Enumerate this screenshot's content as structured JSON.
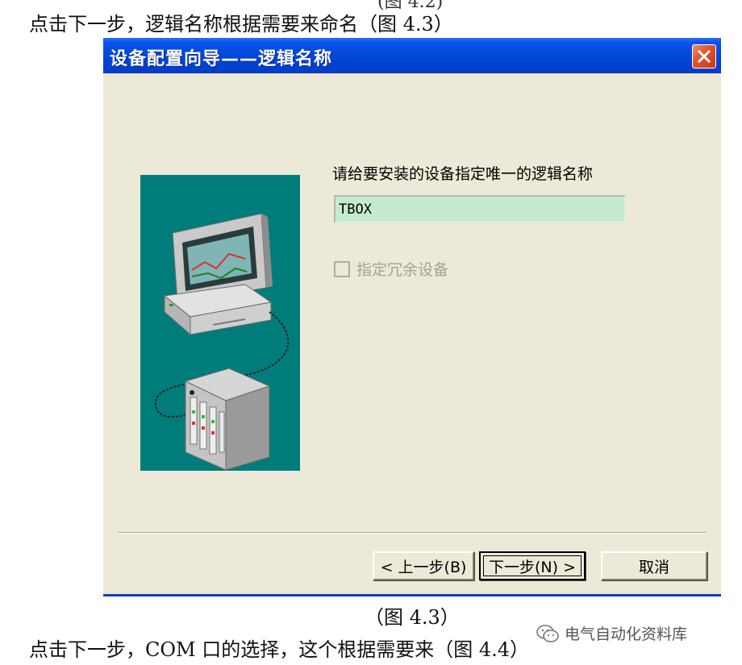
{
  "document": {
    "top_cut_text": "(图 4.2)",
    "top_line": "点击下一步，逻辑名称根据需要来命名（图 4.3）",
    "caption": "（图 4.3）",
    "bottom_line": "点击下一步，COM 口的选择，这个根据需要来（图 4.4）"
  },
  "dialog": {
    "title": "设备配置向导——逻辑名称",
    "close_icon": "close-icon",
    "prompt_label": "请给要安装的设备指定唯一的逻辑名称",
    "logical_name_value": "TBOX",
    "redundant_checkbox_label": "指定冗余设备",
    "redundant_checked": false,
    "buttons": {
      "back": "< 上一步(B)",
      "next": "下一步(N) >",
      "cancel": "取消"
    }
  },
  "watermark": {
    "icon": "wechat-icon",
    "text": "电气自动化资料库"
  },
  "colors": {
    "titlebar": "#0147d9",
    "dialog_bg": "#ece9d8",
    "illustration_bg": "#007d7b",
    "input_bg": "#c5ebcf",
    "close_button": "#e0522a"
  }
}
